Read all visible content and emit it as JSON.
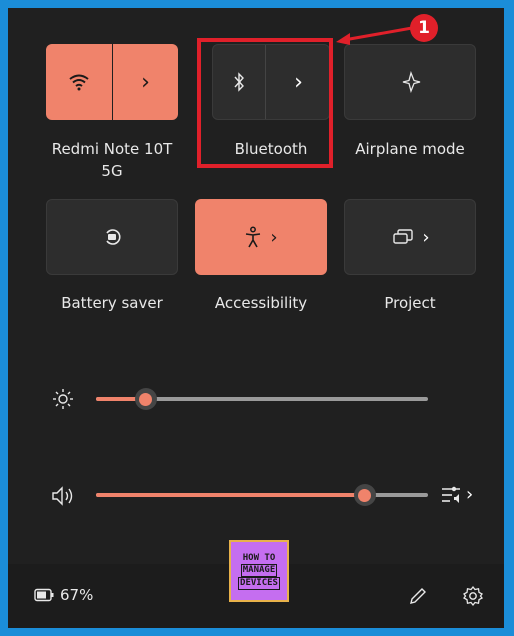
{
  "tiles": {
    "wifi": {
      "label": "Redmi Note 10T 5G",
      "label_line1": "Redmi Note 10T",
      "label_line2": "5G",
      "state": "on",
      "icon": "wifi-icon"
    },
    "bluetooth": {
      "label": "Bluetooth",
      "state": "off",
      "icon": "bluetooth-icon"
    },
    "airplane": {
      "label": "Airplane mode",
      "state": "off",
      "icon": "airplane-icon"
    },
    "battery_saver": {
      "label": "Battery saver",
      "state": "off",
      "icon": "battery-saver-icon"
    },
    "accessibility": {
      "label": "Accessibility",
      "state": "on",
      "icon": "accessibility-icon"
    },
    "project": {
      "label": "Project",
      "state": "off",
      "icon": "project-icon"
    }
  },
  "sliders": {
    "brightness": {
      "value": 0.15,
      "icon": "brightness-icon"
    },
    "volume": {
      "value": 0.81,
      "icon": "volume-icon",
      "end_icon": "sound-output-icon"
    }
  },
  "status": {
    "battery": "67%"
  },
  "annotation": {
    "badge": "1"
  },
  "logo": {
    "line1": "HOW TO",
    "line2": "MANAGE",
    "line3": "DEVICES"
  },
  "colors": {
    "accent": "#f0836b",
    "panel": "#202020",
    "highlight": "#e0202a",
    "frame": "#1b8dd8"
  }
}
